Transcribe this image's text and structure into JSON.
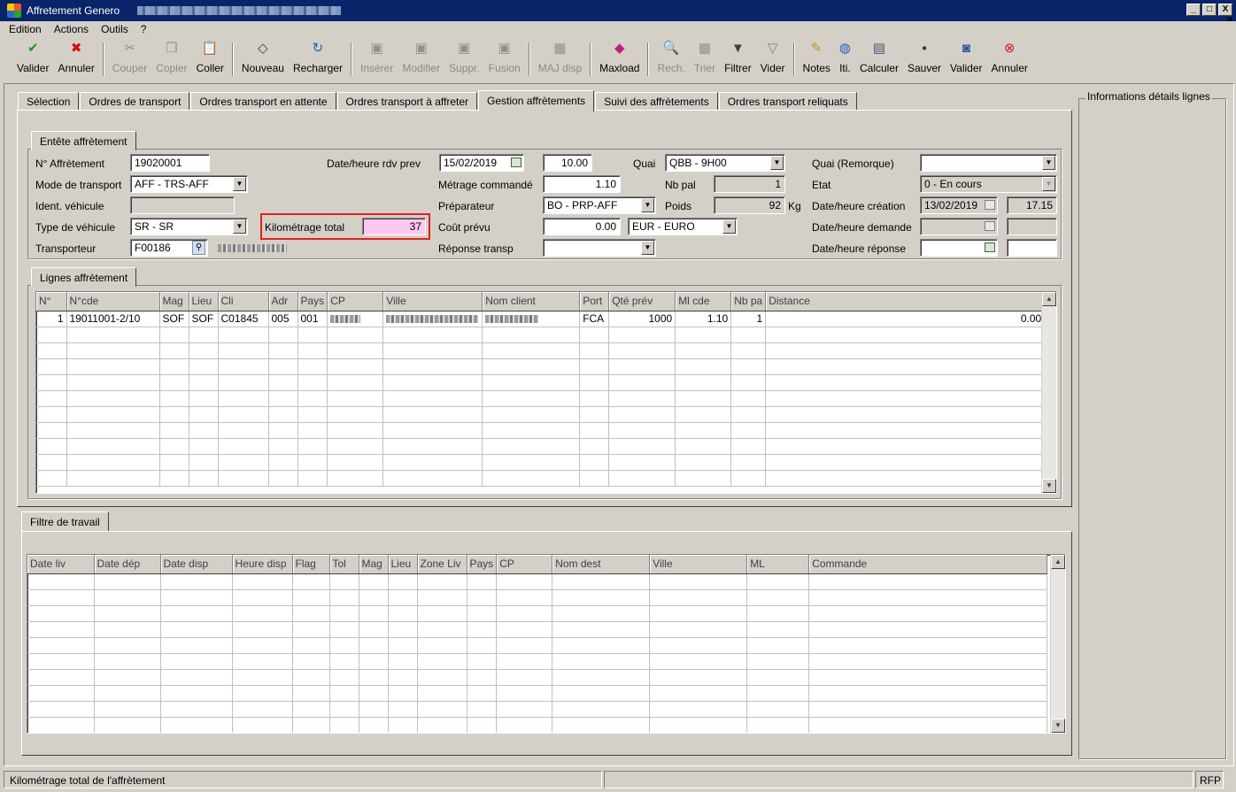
{
  "window": {
    "title": "Affretement Genero",
    "controls": [
      "_",
      "□",
      "X"
    ]
  },
  "menu": [
    "Edition",
    "Actions",
    "Outils",
    "?"
  ],
  "toolbar": [
    {
      "label": "Valider",
      "icon": "✔",
      "color": "#1a9a1a",
      "enabled": true
    },
    {
      "label": "Annuler",
      "icon": "✖",
      "color": "#d01010",
      "enabled": true
    },
    {
      "sep": true
    },
    {
      "label": "Couper",
      "icon": "✂",
      "color": "#909090",
      "enabled": false
    },
    {
      "label": "Copier",
      "icon": "❐",
      "color": "#909090",
      "enabled": false
    },
    {
      "label": "Coller",
      "icon": "📋",
      "color": "#7a5a20",
      "enabled": true
    },
    {
      "sep": true
    },
    {
      "label": "Nouveau",
      "icon": "◇",
      "color": "#404040",
      "enabled": true
    },
    {
      "label": "Recharger",
      "icon": "↻",
      "color": "#1a60c0",
      "enabled": true
    },
    {
      "sep": true
    },
    {
      "label": "Insérer",
      "icon": "▣",
      "color": "#909090",
      "enabled": false
    },
    {
      "label": "Modifier",
      "icon": "▣",
      "color": "#909090",
      "enabled": false
    },
    {
      "label": "Suppr.",
      "icon": "▣",
      "color": "#909090",
      "enabled": false
    },
    {
      "label": "Fusion",
      "icon": "▣",
      "color": "#909090",
      "enabled": false
    },
    {
      "sep": true
    },
    {
      "label": "MAJ disp",
      "icon": "▦",
      "color": "#909090",
      "enabled": false
    },
    {
      "sep": true
    },
    {
      "label": "Maxload",
      "icon": "◆",
      "color": "#c02080",
      "enabled": true
    },
    {
      "sep": true
    },
    {
      "label": "Rech.",
      "icon": "🔍",
      "color": "#909090",
      "enabled": false
    },
    {
      "label": "Trier",
      "icon": "▦",
      "color": "#909090",
      "enabled": false
    },
    {
      "label": "Filtrer",
      "icon": "▼",
      "color": "#404040",
      "enabled": true
    },
    {
      "label": "Vider",
      "icon": "▽",
      "color": "#808080",
      "enabled": true
    },
    {
      "sep": true
    },
    {
      "label": "Notes",
      "icon": "✎",
      "color": "#c09020",
      "enabled": true
    },
    {
      "label": "Iti.",
      "icon": "◍",
      "color": "#2060c0",
      "enabled": true
    },
    {
      "label": "Calculer",
      "icon": "▤",
      "color": "#505070",
      "enabled": true
    },
    {
      "label": "Sauver",
      "icon": "▪",
      "color": "#303030",
      "enabled": true
    },
    {
      "label": "Valider",
      "icon": "◙",
      "color": "#3050a0",
      "enabled": true
    },
    {
      "label": "Annuler",
      "icon": "⊗",
      "color": "#d02020",
      "enabled": true
    }
  ],
  "toolbar_more": "»",
  "tabs": [
    {
      "label": "Sélection",
      "active": false
    },
    {
      "label": "Ordres de transport",
      "active": false
    },
    {
      "label": "Ordres transport en attente",
      "active": false
    },
    {
      "label": "Ordres transport à affreter",
      "active": false
    },
    {
      "label": "Gestion affrètements",
      "active": true
    },
    {
      "label": "Suivi des affrètements",
      "active": false
    },
    {
      "label": "Ordres transport reliquats",
      "active": false
    }
  ],
  "entete": {
    "title": "Entête affrètement",
    "num_label": "N° Affrètement",
    "num_value": "19020001",
    "mode_label": "Mode de transport",
    "mode_value": "AFF - TRS-AFF",
    "ident_label": "Ident. véhicule",
    "ident_value": "",
    "type_label": "Type de véhicule",
    "type_value": "SR - SR",
    "transporteur_label": "Transporteur",
    "transporteur_value": "F00186",
    "km_label": "Kilométrage total",
    "km_value": "37",
    "rdv_label": "Date/heure rdv prev",
    "rdv_date": "15/02/2019",
    "rdv_time": "10.00",
    "metrage_label": "Métrage commandé",
    "metrage_value": "1.10",
    "preparateur_label": "Préparateur",
    "preparateur_value": "BO - PRP-AFF",
    "cout_label": "Coût prévu",
    "cout_value": "0.00",
    "devise_value": "EUR - EURO",
    "reponse_transp_label": "Réponse transp",
    "reponse_transp_value": "",
    "quai_label": "Quai",
    "quai_value": "QBB - 9H00",
    "nbpal_label": "Nb pal",
    "nbpal_value": "1",
    "poids_label": "Poids",
    "poids_value": "92",
    "poids_unit": "Kg",
    "quai_rem_label": "Quai (Remorque)",
    "quai_rem_value": "",
    "etat_label": "Etat",
    "etat_value": "0 - En cours",
    "creation_label": "Date/heure création",
    "creation_date": "13/02/2019",
    "creation_time": "17.15",
    "demande_label": "Date/heure demande",
    "demande_date": "",
    "demande_time": "",
    "reponse_label": "Date/heure réponse",
    "reponse_date": "",
    "reponse_time": ""
  },
  "lignes": {
    "title": "Lignes affrètement",
    "columns": [
      "N°",
      "N°cde",
      "Mag",
      "Lieu",
      "Cli",
      "Adr",
      "Pays",
      "CP",
      "Ville",
      "Nom client",
      "Port",
      "Qté prév",
      "Ml cde",
      "Nb pa",
      "Distance"
    ],
    "rows": [
      {
        "n": "1",
        "cde": "19011001-2/10",
        "mag": "SOF",
        "lieu": "SOF",
        "cli": "C01845",
        "adr": "005",
        "pays": "001",
        "cp": "",
        "ville": "",
        "nom": "",
        "port": "FCA",
        "qte": "1000",
        "ml": "1.10",
        "nbpa": "1",
        "distance": "0.00"
      }
    ]
  },
  "filtre": {
    "title": "Filtre de travail",
    "columns": [
      "Date liv",
      "Date dép",
      "Date disp",
      "Heure disp",
      "Flag",
      "Tol",
      "Mag",
      "Lieu",
      "Zone Liv",
      "Pays",
      "CP",
      "Nom dest",
      "Ville",
      "ML",
      "Commande"
    ]
  },
  "right_panel": {
    "title": "Informations détails lignes"
  },
  "status": {
    "message": "Kilométrage total de l'affrètement",
    "right": "RFP"
  }
}
